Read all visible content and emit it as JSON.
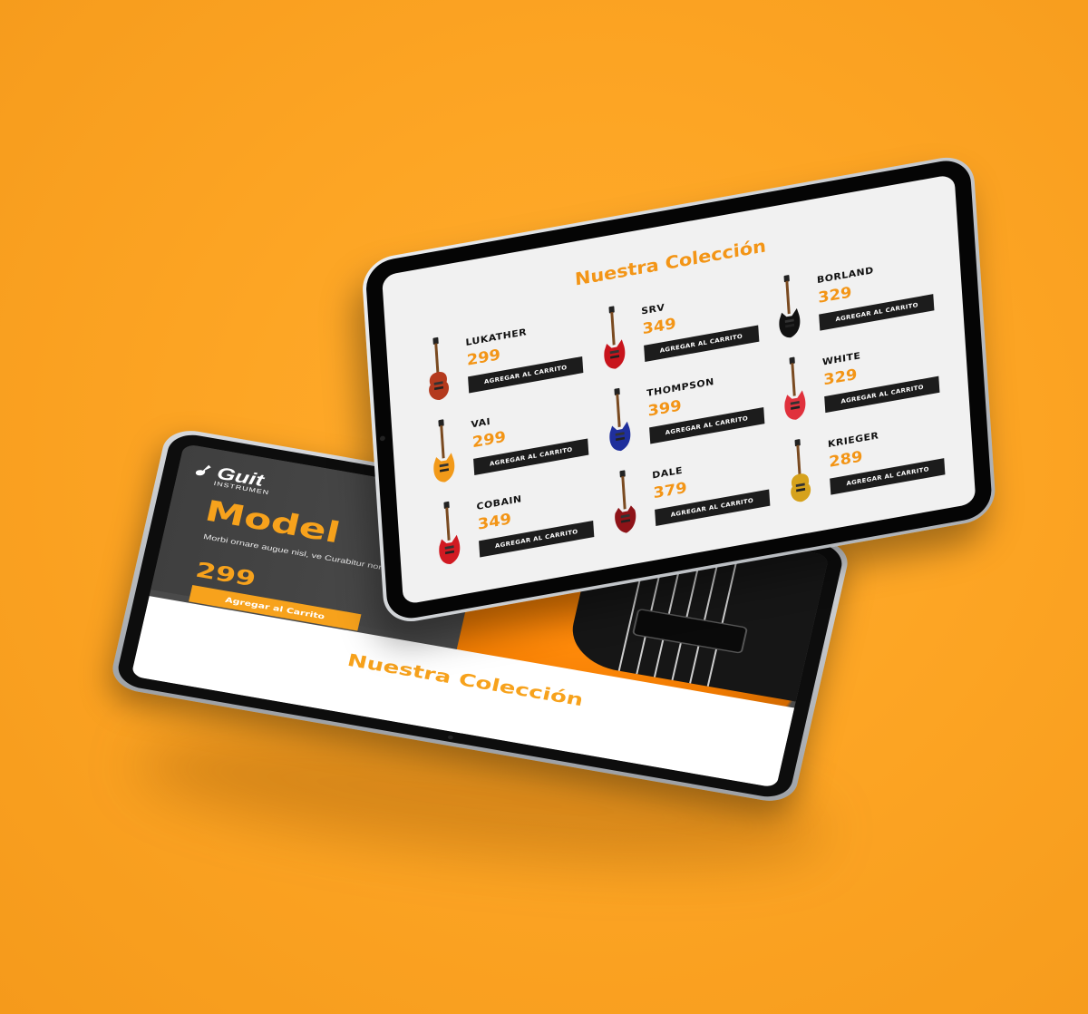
{
  "back_screen": {
    "logo_text": "Guit",
    "logo_sub": "INSTRUMEN",
    "hero_title": "Model",
    "hero_text": "Morbi ornare augue nisl, ve Curabitur non ex id eros ferr",
    "hero_price": "299",
    "add_button": "Agregar al Carrito",
    "collection_title": "Nuestra Colección"
  },
  "front_screen": {
    "collection_title": "Nuestra Colección",
    "guitars": [
      {
        "name": "LUKATHER",
        "price": "299",
        "button": "AGREGAR AL CARRITO",
        "color": "#b43a1e",
        "shape": "lespaul"
      },
      {
        "name": "SRV",
        "price": "349",
        "button": "AGREGAR AL CARRITO",
        "color": "#c8141c",
        "shape": "strat"
      },
      {
        "name": "BORLAND",
        "price": "329",
        "button": "AGREGAR AL CARRITO",
        "color": "#111111",
        "shape": "strat"
      },
      {
        "name": "VAI",
        "price": "299",
        "button": "AGREGAR AL CARRITO",
        "color": "#f29a1a",
        "shape": "strat"
      },
      {
        "name": "THOMPSON",
        "price": "399",
        "button": "AGREGAR AL CARRITO",
        "color": "#1f2f9c",
        "shape": "strat"
      },
      {
        "name": "WHITE",
        "price": "329",
        "button": "AGREGAR AL CARRITO",
        "color": "#e0313c",
        "shape": "strat"
      },
      {
        "name": "COBAIN",
        "price": "349",
        "button": "AGREGAR AL CARRITO",
        "color": "#d11a22",
        "shape": "strat"
      },
      {
        "name": "DALE",
        "price": "379",
        "button": "AGREGAR AL CARRITO",
        "color": "#8e1318",
        "shape": "sg"
      },
      {
        "name": "KRIEGER",
        "price": "289",
        "button": "AGREGAR AL CARRITO",
        "color": "#d6a21c",
        "shape": "lespaul"
      }
    ]
  },
  "colors": {
    "background": "#fda524",
    "accent": "#f39516",
    "button_dark": "#1c1c1c"
  }
}
